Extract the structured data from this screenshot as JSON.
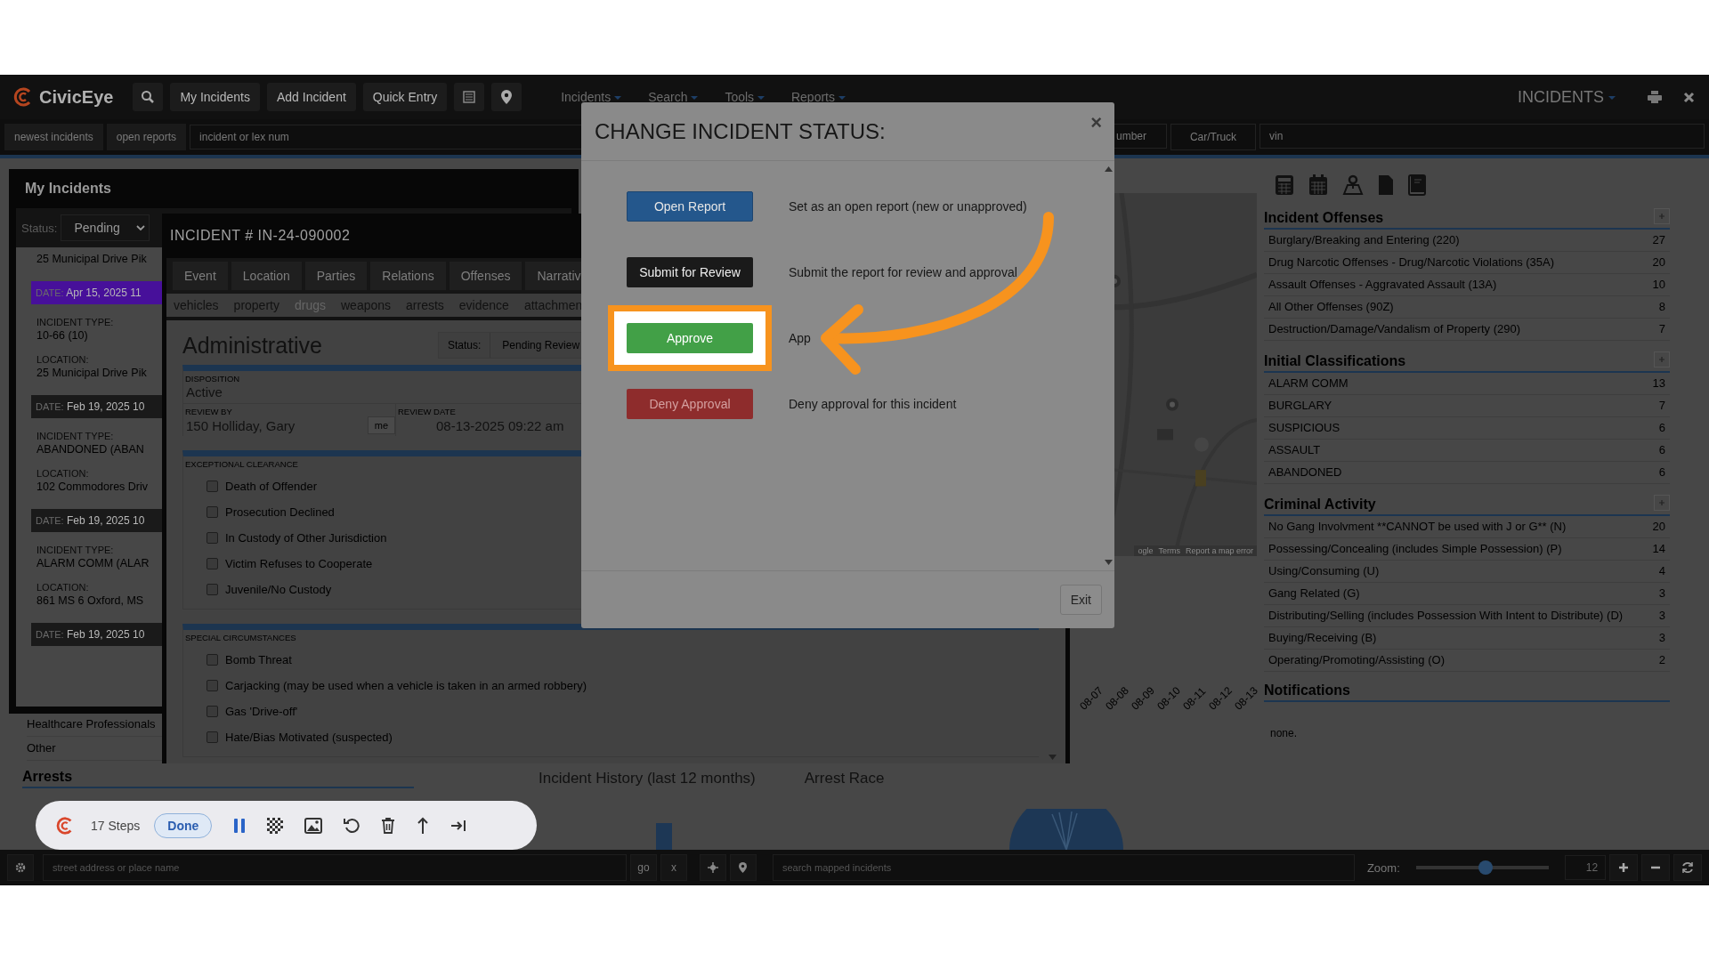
{
  "navbar": {
    "brand": "CivicEye",
    "buttons": [
      "My Incidents",
      "Add Incident",
      "Quick Entry"
    ],
    "menus": [
      "Incidents",
      "Search",
      "Tools",
      "Reports"
    ],
    "module": "INCIDENTS"
  },
  "subnav": {
    "tabs": [
      "newest incidents",
      "open reports"
    ],
    "search_placeholder": "incident or lex num",
    "right_items": [
      {
        "kind": "field",
        "placeholder": "umber"
      },
      {
        "kind": "button",
        "label": "Car/Truck"
      },
      {
        "kind": "field",
        "placeholder": "vin"
      }
    ]
  },
  "my_incidents": {
    "title": "My Incidents",
    "status_label": "Status:",
    "status_value": "Pending",
    "first_location": "25 Municipal Drive Pik",
    "items": [
      {
        "date_label": "DATE:",
        "date": "Apr 15, 2025 11",
        "selected": true,
        "type_label": "INCIDENT TYPE:",
        "type": "10-66 (10)",
        "location_label": "LOCATION:",
        "location": "25 Municipal Drive Pik"
      },
      {
        "date_label": "DATE:",
        "date": "Feb 19, 2025 10",
        "selected": false,
        "type_label": "INCIDENT TYPE:",
        "type": "ABANDONED (ABAN",
        "location_label": "LOCATION:",
        "location": "102 Commodores Driv"
      },
      {
        "date_label": "DATE:",
        "date": "Feb 19, 2025 10",
        "selected": false,
        "type_label": "INCIDENT TYPE:",
        "type": "ALARM COMM (ALAR",
        "location_label": "LOCATION:",
        "location": "861 MS 6 Oxford, MS"
      },
      {
        "date_label": "DATE:",
        "date": "Feb 19, 2025 10",
        "selected": false
      }
    ]
  },
  "incident": {
    "title": "INCIDENT # IN-24-090002",
    "tabs": [
      "Event",
      "Location",
      "Parties",
      "Relations",
      "Offenses",
      "Narrativ"
    ],
    "subtabs": [
      {
        "label": "vehicles",
        "disabled": false
      },
      {
        "label": "property",
        "disabled": false
      },
      {
        "label": "drugs",
        "disabled": true
      },
      {
        "label": "weapons",
        "disabled": false
      },
      {
        "label": "arrests",
        "disabled": false
      },
      {
        "label": "evidence",
        "disabled": false
      },
      {
        "label": "attachmen",
        "disabled": false
      }
    ],
    "section_title": "Administrative",
    "status_label": "Status:",
    "status_value": "Pending Review",
    "disposition_label": "DISPOSITION",
    "disposition": "Active",
    "review_by_label": "REVIEW BY",
    "review_by": "150 Holliday, Gary",
    "me_button": "me",
    "review_date_label": "REVIEW DATE",
    "review_date": "08-13-2025 09:22 am",
    "groups": [
      {
        "title": "EXCEPTIONAL CLEARANCE",
        "options": [
          {
            "label": "Death of Offender",
            "checked": false
          },
          {
            "label": "Prosecution Declined",
            "checked": false
          },
          {
            "label": "In Custody of Other Jurisdiction",
            "checked": false
          },
          {
            "label": "Victim Refuses to Cooperate",
            "checked": false
          },
          {
            "label": "Juvenile/No Custody",
            "checked": false
          }
        ]
      },
      {
        "title": "SPECIAL CIRCUMSTANCES",
        "options": [
          {
            "label": "Bomb Threat",
            "checked": false
          },
          {
            "label": "Carjacking (may be used when a vehicle is taken in an armed robbery)",
            "checked": false
          },
          {
            "label": "Gas 'Drive-off'",
            "checked": false
          },
          {
            "label": "Hate/Bias Motivated (suspected)",
            "checked": false
          }
        ]
      }
    ]
  },
  "lower_left": {
    "rows": [
      "Healthcare Professionals",
      "Other"
    ],
    "arrests_title": "Arrests"
  },
  "map": {
    "attribution": [
      "ogle",
      "Terms",
      "Report a map error"
    ]
  },
  "charts": {
    "history_title": "Incident History (last 12 months)",
    "history_dates": [
      "08-07",
      "08-08",
      "08-09",
      "08-10",
      "08-11",
      "08-12",
      "08-13"
    ],
    "race_title": "Arrest Race"
  },
  "right_panel": {
    "sections": [
      {
        "title": "Incident Offenses",
        "rows": [
          {
            "label": "Burglary/Breaking and Entering (220)",
            "count": "27"
          },
          {
            "label": "Drug Narcotic Offenses - Drug/Narcotic Violations (35A)",
            "count": "20"
          },
          {
            "label": "Assault Offenses - Aggravated Assault (13A)",
            "count": "10"
          },
          {
            "label": "All Other Offenses (90Z)",
            "count": "8"
          },
          {
            "label": "Destruction/Damage/Vandalism of Property (290)",
            "count": "7"
          }
        ]
      },
      {
        "title": "Initial Classifications",
        "rows": [
          {
            "label": "ALARM COMM",
            "count": "13"
          },
          {
            "label": "BURGLARY",
            "count": "7"
          },
          {
            "label": "SUSPICIOUS",
            "count": "6"
          },
          {
            "label": "ASSAULT",
            "count": "6"
          },
          {
            "label": "ABANDONED",
            "count": "6"
          }
        ]
      },
      {
        "title": "Criminal Activity",
        "rows": [
          {
            "label": "No Gang Involvment **CANNOT be used with J or G** (N)",
            "count": "20"
          },
          {
            "label": "Possessing/Concealing (includes Simple Possession) (P)",
            "count": "14"
          },
          {
            "label": "Using/Consuming (U)",
            "count": "4"
          },
          {
            "label": "Gang Related (G)",
            "count": "3"
          },
          {
            "label": "Distributing/Selling (includes Possession With Intent to Distribute) (D)",
            "count": "3"
          },
          {
            "label": "Buying/Receiving (B)",
            "count": "3"
          },
          {
            "label": "Operating/Promoting/Assisting (O)",
            "count": "2"
          }
        ]
      }
    ],
    "notifications_title": "Notifications",
    "notifications_text": "none."
  },
  "bottom_bar": {
    "address_placeholder": "street address or place name",
    "go": "go",
    "clear": "x",
    "search_placeholder": "search mapped incidents",
    "zoom_label": "Zoom:",
    "zoom": {
      "level": 0.52
    },
    "zoom_value": "12"
  },
  "modal": {
    "title": "CHANGE INCIDENT STATUS:",
    "close": "×",
    "options": [
      {
        "kind": "primary",
        "label": "Open Report",
        "description": "Set as an open report (new or unapproved)",
        "highlighted": false
      },
      {
        "kind": "dark",
        "label": "Submit for Review",
        "description": "Submit the report for review and approval",
        "highlighted": false
      },
      {
        "kind": "success",
        "label": "Approve",
        "description": "App",
        "highlighted": true
      },
      {
        "kind": "danger",
        "label": "Deny Approval",
        "description": "Deny approval for this incident",
        "highlighted": false
      }
    ],
    "exit": "Exit"
  },
  "recorder": {
    "steps": "17 Steps",
    "done": "Done"
  }
}
